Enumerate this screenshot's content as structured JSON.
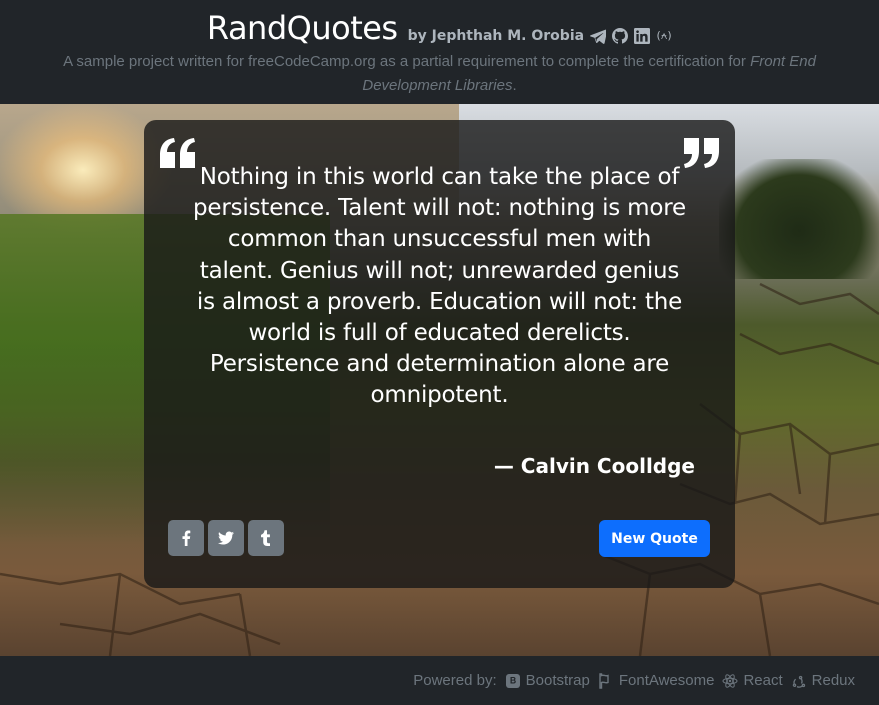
{
  "header": {
    "title": "RandQuotes",
    "byline": "by Jephthah M. Orobia",
    "icons": [
      "telegram-icon",
      "github-icon",
      "linkedin-icon",
      "gatsby-icon"
    ],
    "subtitle_main": "A sample project written for freeCodeCamp.org  as a partial requirement to complete the certification for",
    "subtitle_em": "Front End Development Libraries",
    "subtitle_end": "."
  },
  "quote": {
    "text": "Nothing in this world can take the place of persistence. Talent will not: nothing is more common than unsuccessful men with talent. Genius will not; unrewarded genius is almost a proverb. Education will not: the world is full of educated derelicts. Persistence and determination alone are omnipotent.",
    "author": "— Calvin Coolldge"
  },
  "actions": {
    "share": [
      "facebook-icon",
      "twitter-icon",
      "tumblr-icon"
    ],
    "new_quote_label": "New Quote"
  },
  "footer": {
    "powered_by": "Powered by:",
    "items": [
      "Bootstrap",
      "FontAwesome",
      "React",
      "Redux"
    ]
  },
  "colors": {
    "background": "#212529",
    "card": "#181818cc",
    "primary": "#0d6efd",
    "secondary": "#6c757d",
    "muted": "#adb5bd"
  }
}
